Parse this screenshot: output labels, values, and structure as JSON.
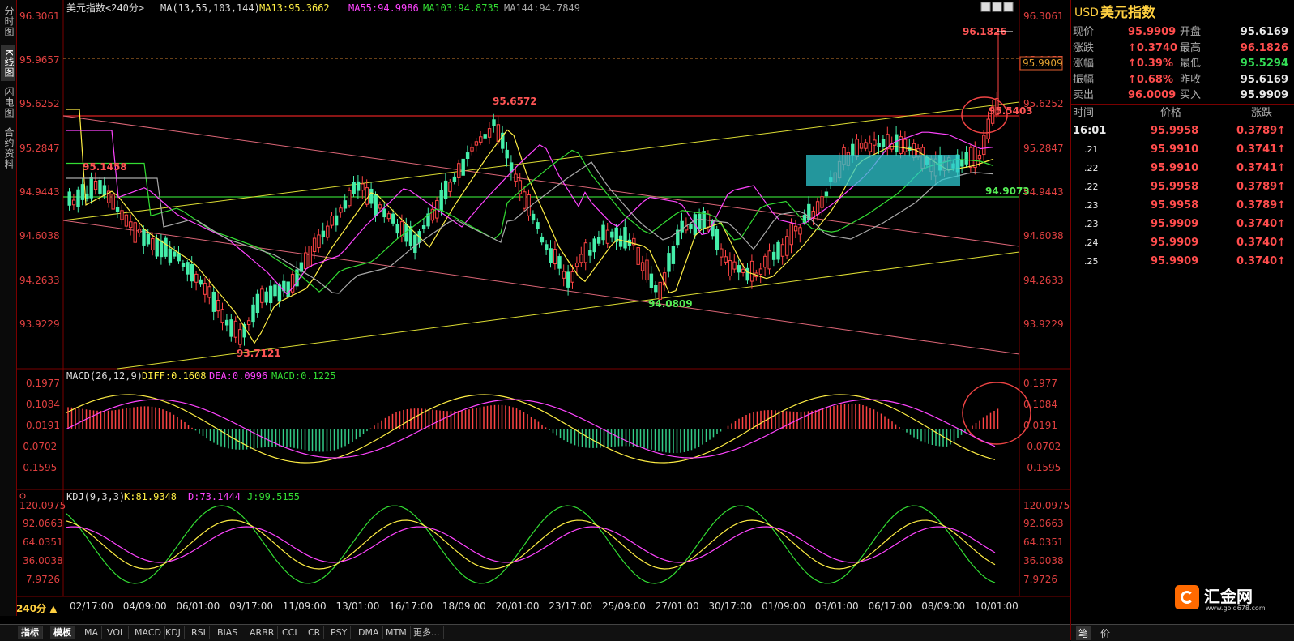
{
  "left_tabs": [
    "分时图",
    "K线图",
    "闪电图",
    "合约资料"
  ],
  "active_left_tab": 1,
  "header": {
    "symbol_title": "美元指数<240分>",
    "ma_label": "MA(13,55,103,144)",
    "ma13": "MA13:95.3662",
    "ma55": "MA55:94.9986",
    "ma103": "MA103:94.8735",
    "ma144": "MA144:94.7849"
  },
  "price_axis_left": [
    "96.3061",
    "95.9657",
    "95.6252",
    "95.2847",
    "94.9443",
    "94.6038",
    "94.2633",
    "93.9229"
  ],
  "price_axis_right": [
    "96.3061",
    "95.9657",
    "95.6252",
    "95.2847",
    "94.9443",
    "94.6038",
    "94.2633",
    "93.9229"
  ],
  "current_price_tag": "95.9909",
  "annotations": {
    "high": "96.1826",
    "peak1": "95.6572",
    "left_high": "95.1458",
    "low1": "93.7121",
    "low2": "94.0809",
    "ma_level": "94.9073",
    "recent": "95.5403"
  },
  "macd": {
    "title": "MACD(26,12,9)",
    "diff": "DIFF:0.1608",
    "dea": "DEA:0.0996",
    "macd": "MACD:0.1225",
    "axis": [
      "0.1977",
      "0.1084",
      "0.0191",
      "-0.0702",
      "-0.1595"
    ]
  },
  "kdj": {
    "title": "KDJ(9,3,3)",
    "k": "K:81.9348",
    "d": "D:73.1444",
    "j": "J:99.5155",
    "axis": [
      "120.0975",
      "92.0663",
      "64.0351",
      "36.0038",
      "7.9726"
    ]
  },
  "x_labels": [
    "02/17:00",
    "04/09:00",
    "06/01:00",
    "09/17:00",
    "11/09:00",
    "13/01:00",
    "16/17:00",
    "18/09:00",
    "20/01:00",
    "23/17:00",
    "25/09:00",
    "27/01:00",
    "30/17:00",
    "01/09:00",
    "03/01:00",
    "06/17:00",
    "08/09:00",
    "10/01:00"
  ],
  "period": "240分 ▲",
  "bottom_tabs": [
    "指标",
    "模板",
    "MA",
    "VOL",
    "MACD",
    "KDJ",
    "RSI",
    "BIAS",
    "ARBR",
    "CCI",
    "CR",
    "PSY",
    "DMA",
    "MTM",
    "更多..."
  ],
  "quote": {
    "code": "USD",
    "name": "美元指数",
    "rows": [
      {
        "l1": "现价",
        "v1": "95.9909",
        "l2": "开盘",
        "v2": "95.6169"
      },
      {
        "l1": "涨跌",
        "v1": "↑0.3740",
        "l2": "最高",
        "v2": "96.1826"
      },
      {
        "l1": "涨幅",
        "v1": "↑0.39%",
        "l2": "最低",
        "v2": "95.5294"
      },
      {
        "l1": "振幅",
        "v1": "↑0.68%",
        "l2": "昨收",
        "v2": "95.6169"
      },
      {
        "l1": "卖出",
        "v1": "96.0009",
        "l2": "买入",
        "v2": "95.9909"
      }
    ]
  },
  "ticks": {
    "headers": [
      "时间",
      "价格",
      "涨跌"
    ],
    "rows": [
      {
        "t": "16:01",
        "p": "95.9958",
        "c": "0.3789↑"
      },
      {
        "t": ".21",
        "p": "95.9910",
        "c": "0.3741↑"
      },
      {
        "t": ".22",
        "p": "95.9910",
        "c": "0.3741↑"
      },
      {
        "t": ".22",
        "p": "95.9958",
        "c": "0.3789↑"
      },
      {
        "t": ".23",
        "p": "95.9958",
        "c": "0.3789↑"
      },
      {
        "t": ".23",
        "p": "95.9909",
        "c": "0.3740↑"
      },
      {
        "t": ".24",
        "p": "95.9909",
        "c": "0.3740↑"
      },
      {
        "t": ".25",
        "p": "95.9909",
        "c": "0.3740↑"
      }
    ]
  },
  "right_bottom_tabs": [
    "笔",
    "价"
  ],
  "logo": {
    "name": "汇金网",
    "url_text": "www.gold678.com"
  }
}
